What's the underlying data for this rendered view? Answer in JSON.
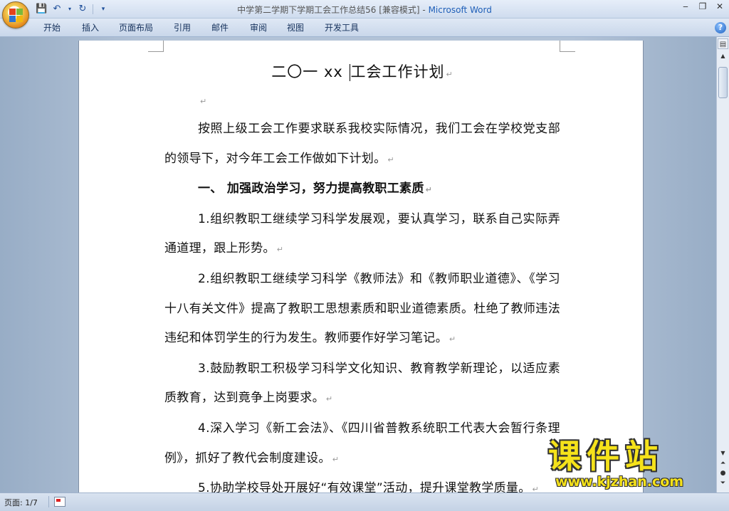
{
  "window": {
    "title_doc": "中学第二学期下学期工会工作总结56 [兼容模式] - ",
    "title_app": "Microsoft Word",
    "controls": [
      "‒",
      "❐",
      "✕"
    ]
  },
  "ribbon": {
    "tabs": [
      "开始",
      "插入",
      "页面布局",
      "引用",
      "邮件",
      "审阅",
      "视图",
      "开发工具"
    ]
  },
  "document": {
    "title_left": "二〇一 xx ",
    "title_right": "工会工作计划",
    "para_mark": "↵",
    "paragraphs": [
      {
        "text": "按照上级工会工作要求联系我校实际情况，我们工会在学校党支部的领导下，对今年工会工作做如下计划。",
        "heading": false
      },
      {
        "text": "一、 加强政治学习，努力提高教职工素质",
        "heading": true
      },
      {
        "text": "1.组织教职工继续学习科学发展观，要认真学习，联系自己实际弄通道理，跟上形势。",
        "heading": false
      },
      {
        "text": "2.组织教职工继续学习科学《教师法》和《教师职业道德》、《学习十八有关文件》提高了教职工思想素质和职业道德素质。杜绝了教师违法违纪和体罚学生的行为发生。教师要作好学习笔记。",
        "heading": false
      },
      {
        "text": "3.鼓励教职工积极学习科学文化知识、教育教学新理论，以适应素质教育，达到竟争上岗要求。",
        "heading": false
      },
      {
        "text": "4.深入学习《新工会法》、《四川省普教系统职工代表大会暂行条理例》，抓好了教代会制度建设。",
        "heading": false
      },
      {
        "text": "5.协助学校导处开展好“有效课堂”活动，提升课堂教学质量。",
        "heading": false
      }
    ]
  },
  "statusbar": {
    "page": "页面: 1/7"
  },
  "watermark": {
    "brand": "课件站",
    "url": "www.kjzhan.com"
  }
}
